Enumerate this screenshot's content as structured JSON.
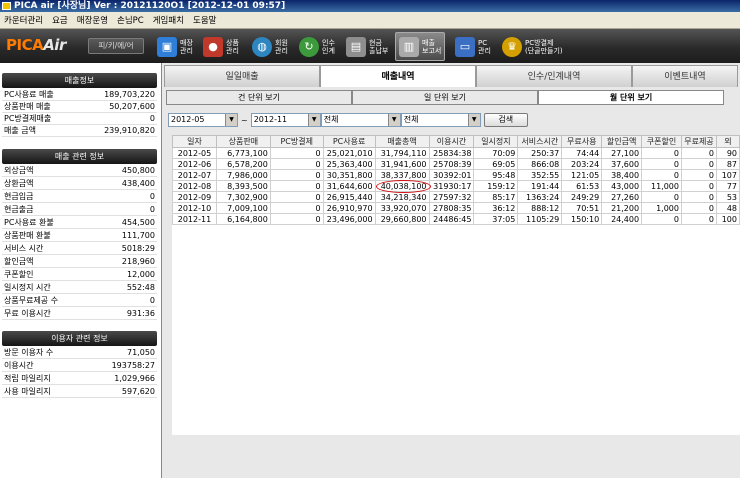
{
  "window": {
    "title": "PICA air [사장님]  Ver : 20121120O1  [2012-12-01 09:57]"
  },
  "menu": [
    "카운터관리",
    "요금",
    "매장운영",
    "손님PC",
    "게임패치",
    "도움말"
  ],
  "toolbar": {
    "logo_main": "PICA",
    "logo_sub": "Air",
    "program_button": "피/키/에/어",
    "buttons": [
      {
        "label1": "매장",
        "label2": "관리",
        "icon": "monitor-icon",
        "color": "#2f7fd8"
      },
      {
        "label1": "상품",
        "label2": "관리",
        "icon": "food-icon",
        "color": "#c0392b"
      },
      {
        "label1": "회원",
        "label2": "관리",
        "icon": "globe-icon",
        "color": "#2e86c1"
      },
      {
        "label1": "인수",
        "label2": "인계",
        "icon": "circle-arrow-icon",
        "color": "#3c9a3c"
      },
      {
        "label1": "현금",
        "label2": "출납부",
        "icon": "cash-register-icon",
        "color": "#8e8e8e"
      },
      {
        "label1": "매출",
        "label2": "보고서",
        "icon": "chart-icon",
        "color": "#aaaaaa"
      },
      {
        "label1": "PC",
        "label2": "관리",
        "icon": "pc-icon",
        "color": "#3a6fc4"
      },
      {
        "label1": "PC방결제",
        "label2": "(단골만들기)",
        "icon": "crown-icon",
        "color": "#d4a000"
      }
    ]
  },
  "sidebar": {
    "sales_header": "매출정보",
    "sales": [
      {
        "k": "PC사용료 매출",
        "v": "189,703,220"
      },
      {
        "k": "상품판매 매출",
        "v": "50,207,600"
      },
      {
        "k": "PC방결제매출",
        "v": "0"
      },
      {
        "k": "매출 금액",
        "v": "239,910,820"
      }
    ],
    "related_header": "매출 관련 정보",
    "related": [
      {
        "k": "외상금액",
        "v": "450,800"
      },
      {
        "k": "상환금액",
        "v": "438,400"
      },
      {
        "k": "현금입금",
        "v": "0"
      },
      {
        "k": "현금출금",
        "v": "0"
      },
      {
        "k": "PC사용료 환불",
        "v": "454,500"
      },
      {
        "k": "상품판매 환불",
        "v": "111,700"
      },
      {
        "k": "서비스 시간",
        "v": "5018:29"
      },
      {
        "k": "할인금액",
        "v": "218,960"
      },
      {
        "k": "쿠폰할인",
        "v": "12,000"
      },
      {
        "k": "일시정지 시간",
        "v": "552:48"
      },
      {
        "k": "상품무료제공 수",
        "v": "0"
      },
      {
        "k": "무료 이용시간",
        "v": "931:36"
      }
    ],
    "user_header": "이용자 관련 정보",
    "users": [
      {
        "k": "방문 이용자 수",
        "v": "71,050"
      },
      {
        "k": "이용시간",
        "v": "193758:27"
      },
      {
        "k": "적립 마일리지",
        "v": "1,029,966"
      },
      {
        "k": "사용 마일리지",
        "v": "597,620"
      }
    ]
  },
  "tabs": [
    "일일매출",
    "매출내역",
    "인수/인계내역",
    "이벤트내역"
  ],
  "subtabs": [
    "건 단위 보기",
    "일 단위 보기",
    "월 단위 보기"
  ],
  "filters": {
    "from": "2012-05",
    "tilde": "~",
    "to": "2012-11",
    "select1": "전체",
    "select2": "전체",
    "search": "검색"
  },
  "table": {
    "headers": [
      "일자",
      "상품판매",
      "PC방결제",
      "PC사용료",
      "매출총액",
      "이용시간",
      "일시정지",
      "서비스시간",
      "무료사용",
      "할인금액",
      "쿠폰할인",
      "무료제공",
      "외"
    ],
    "rows": [
      [
        "2012-05",
        "6,773,100",
        "0",
        "25,021,010",
        "31,794,110",
        "25834:38",
        "70:09",
        "250:37",
        "74:44",
        "27,100",
        "0",
        "0",
        "90"
      ],
      [
        "2012-06",
        "6,578,200",
        "0",
        "25,363,400",
        "31,941,600",
        "25708:39",
        "69:05",
        "866:08",
        "203:24",
        "37,600",
        "0",
        "0",
        "87"
      ],
      [
        "2012-07",
        "7,986,000",
        "0",
        "30,351,800",
        "38,337,800",
        "30392:01",
        "95:48",
        "352:55",
        "121:05",
        "38,400",
        "0",
        "0",
        "107"
      ],
      [
        "2012-08",
        "8,393,500",
        "0",
        "31,644,600",
        "40,038,100",
        "31930:17",
        "159:12",
        "191:44",
        "61:53",
        "43,000",
        "11,000",
        "0",
        "77"
      ],
      [
        "2012-09",
        "7,302,900",
        "0",
        "26,915,440",
        "34,218,340",
        "27597:32",
        "85:17",
        "1363:24",
        "249:29",
        "27,260",
        "0",
        "0",
        "53"
      ],
      [
        "2012-10",
        "7,009,100",
        "0",
        "26,910,970",
        "33,920,070",
        "27808:35",
        "36:12",
        "888:12",
        "70:51",
        "21,200",
        "1,000",
        "0",
        "48"
      ],
      [
        "2012-11",
        "6,164,800",
        "0",
        "23,496,000",
        "29,660,800",
        "24486:45",
        "37:05",
        "1105:29",
        "150:10",
        "24,400",
        "0",
        "0",
        "100"
      ]
    ]
  }
}
